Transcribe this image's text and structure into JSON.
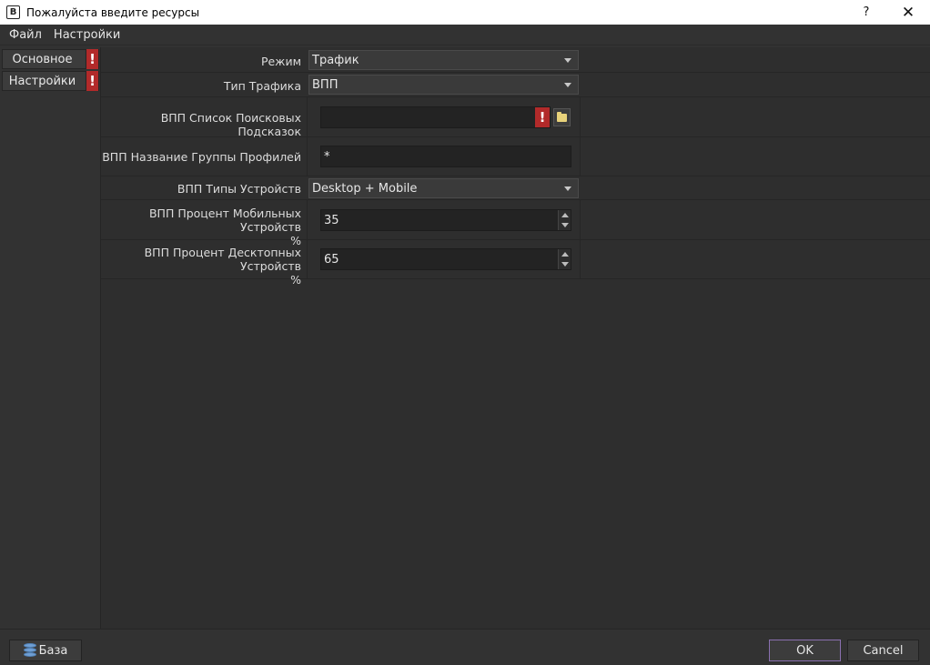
{
  "window": {
    "title": "Пожалуйста введите ресурсы",
    "icon_letter": "B",
    "help_glyph": "?",
    "close_glyph": "✕"
  },
  "menu": {
    "items": [
      "Файл",
      "Настройки"
    ]
  },
  "sidebar": {
    "items": [
      {
        "label": "Основное",
        "warning": "!"
      },
      {
        "label": "Настройки",
        "warning": "!"
      }
    ]
  },
  "form": {
    "mode": {
      "label": "Режим",
      "value": "Трафик"
    },
    "traffic_type": {
      "label": "Тип Трафика",
      "value": "ВПП"
    },
    "suggestions_list": {
      "label": "ВПП Список Поисковых Подсказок",
      "value": "",
      "warning": "!"
    },
    "profile_group": {
      "label": "ВПП Название Группы Профилей",
      "value": "*"
    },
    "device_types": {
      "label": "ВПП Типы Устройств",
      "value": "Desktop + Mobile"
    },
    "mobile_percent": {
      "label_line1": "ВПП Процент Мобильных Устройств",
      "label_line2": "%",
      "value": "35"
    },
    "desktop_percent": {
      "label_line1": "ВПП Процент Десктопных Устройств",
      "label_line2": "%",
      "value": "65"
    }
  },
  "footer": {
    "base_label": "База",
    "ok_label": "OK",
    "cancel_label": "Cancel"
  },
  "colors": {
    "background": "#323232",
    "warning": "#b22a2a",
    "ok_border": "#8a70b0"
  }
}
